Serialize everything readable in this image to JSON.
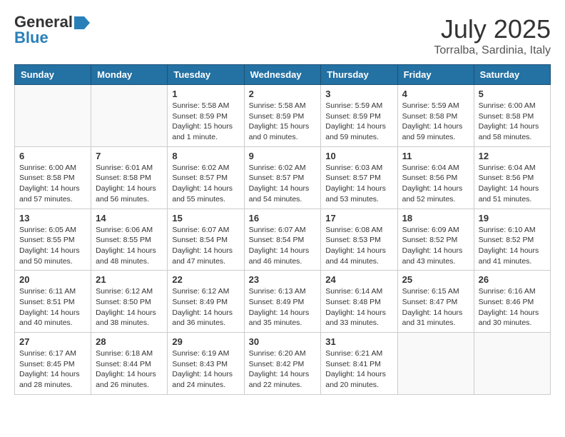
{
  "logo": {
    "general": "General",
    "blue": "Blue"
  },
  "title": "July 2025",
  "location": "Torralba, Sardinia, Italy",
  "weekdays": [
    "Sunday",
    "Monday",
    "Tuesday",
    "Wednesday",
    "Thursday",
    "Friday",
    "Saturday"
  ],
  "weeks": [
    [
      {
        "day": "",
        "info": ""
      },
      {
        "day": "",
        "info": ""
      },
      {
        "day": "1",
        "info": "Sunrise: 5:58 AM\nSunset: 8:59 PM\nDaylight: 15 hours\nand 1 minute."
      },
      {
        "day": "2",
        "info": "Sunrise: 5:58 AM\nSunset: 8:59 PM\nDaylight: 15 hours\nand 0 minutes."
      },
      {
        "day": "3",
        "info": "Sunrise: 5:59 AM\nSunset: 8:59 PM\nDaylight: 14 hours\nand 59 minutes."
      },
      {
        "day": "4",
        "info": "Sunrise: 5:59 AM\nSunset: 8:58 PM\nDaylight: 14 hours\nand 59 minutes."
      },
      {
        "day": "5",
        "info": "Sunrise: 6:00 AM\nSunset: 8:58 PM\nDaylight: 14 hours\nand 58 minutes."
      }
    ],
    [
      {
        "day": "6",
        "info": "Sunrise: 6:00 AM\nSunset: 8:58 PM\nDaylight: 14 hours\nand 57 minutes."
      },
      {
        "day": "7",
        "info": "Sunrise: 6:01 AM\nSunset: 8:58 PM\nDaylight: 14 hours\nand 56 minutes."
      },
      {
        "day": "8",
        "info": "Sunrise: 6:02 AM\nSunset: 8:57 PM\nDaylight: 14 hours\nand 55 minutes."
      },
      {
        "day": "9",
        "info": "Sunrise: 6:02 AM\nSunset: 8:57 PM\nDaylight: 14 hours\nand 54 minutes."
      },
      {
        "day": "10",
        "info": "Sunrise: 6:03 AM\nSunset: 8:57 PM\nDaylight: 14 hours\nand 53 minutes."
      },
      {
        "day": "11",
        "info": "Sunrise: 6:04 AM\nSunset: 8:56 PM\nDaylight: 14 hours\nand 52 minutes."
      },
      {
        "day": "12",
        "info": "Sunrise: 6:04 AM\nSunset: 8:56 PM\nDaylight: 14 hours\nand 51 minutes."
      }
    ],
    [
      {
        "day": "13",
        "info": "Sunrise: 6:05 AM\nSunset: 8:55 PM\nDaylight: 14 hours\nand 50 minutes."
      },
      {
        "day": "14",
        "info": "Sunrise: 6:06 AM\nSunset: 8:55 PM\nDaylight: 14 hours\nand 48 minutes."
      },
      {
        "day": "15",
        "info": "Sunrise: 6:07 AM\nSunset: 8:54 PM\nDaylight: 14 hours\nand 47 minutes."
      },
      {
        "day": "16",
        "info": "Sunrise: 6:07 AM\nSunset: 8:54 PM\nDaylight: 14 hours\nand 46 minutes."
      },
      {
        "day": "17",
        "info": "Sunrise: 6:08 AM\nSunset: 8:53 PM\nDaylight: 14 hours\nand 44 minutes."
      },
      {
        "day": "18",
        "info": "Sunrise: 6:09 AM\nSunset: 8:52 PM\nDaylight: 14 hours\nand 43 minutes."
      },
      {
        "day": "19",
        "info": "Sunrise: 6:10 AM\nSunset: 8:52 PM\nDaylight: 14 hours\nand 41 minutes."
      }
    ],
    [
      {
        "day": "20",
        "info": "Sunrise: 6:11 AM\nSunset: 8:51 PM\nDaylight: 14 hours\nand 40 minutes."
      },
      {
        "day": "21",
        "info": "Sunrise: 6:12 AM\nSunset: 8:50 PM\nDaylight: 14 hours\nand 38 minutes."
      },
      {
        "day": "22",
        "info": "Sunrise: 6:12 AM\nSunset: 8:49 PM\nDaylight: 14 hours\nand 36 minutes."
      },
      {
        "day": "23",
        "info": "Sunrise: 6:13 AM\nSunset: 8:49 PM\nDaylight: 14 hours\nand 35 minutes."
      },
      {
        "day": "24",
        "info": "Sunrise: 6:14 AM\nSunset: 8:48 PM\nDaylight: 14 hours\nand 33 minutes."
      },
      {
        "day": "25",
        "info": "Sunrise: 6:15 AM\nSunset: 8:47 PM\nDaylight: 14 hours\nand 31 minutes."
      },
      {
        "day": "26",
        "info": "Sunrise: 6:16 AM\nSunset: 8:46 PM\nDaylight: 14 hours\nand 30 minutes."
      }
    ],
    [
      {
        "day": "27",
        "info": "Sunrise: 6:17 AM\nSunset: 8:45 PM\nDaylight: 14 hours\nand 28 minutes."
      },
      {
        "day": "28",
        "info": "Sunrise: 6:18 AM\nSunset: 8:44 PM\nDaylight: 14 hours\nand 26 minutes."
      },
      {
        "day": "29",
        "info": "Sunrise: 6:19 AM\nSunset: 8:43 PM\nDaylight: 14 hours\nand 24 minutes."
      },
      {
        "day": "30",
        "info": "Sunrise: 6:20 AM\nSunset: 8:42 PM\nDaylight: 14 hours\nand 22 minutes."
      },
      {
        "day": "31",
        "info": "Sunrise: 6:21 AM\nSunset: 8:41 PM\nDaylight: 14 hours\nand 20 minutes."
      },
      {
        "day": "",
        "info": ""
      },
      {
        "day": "",
        "info": ""
      }
    ]
  ]
}
